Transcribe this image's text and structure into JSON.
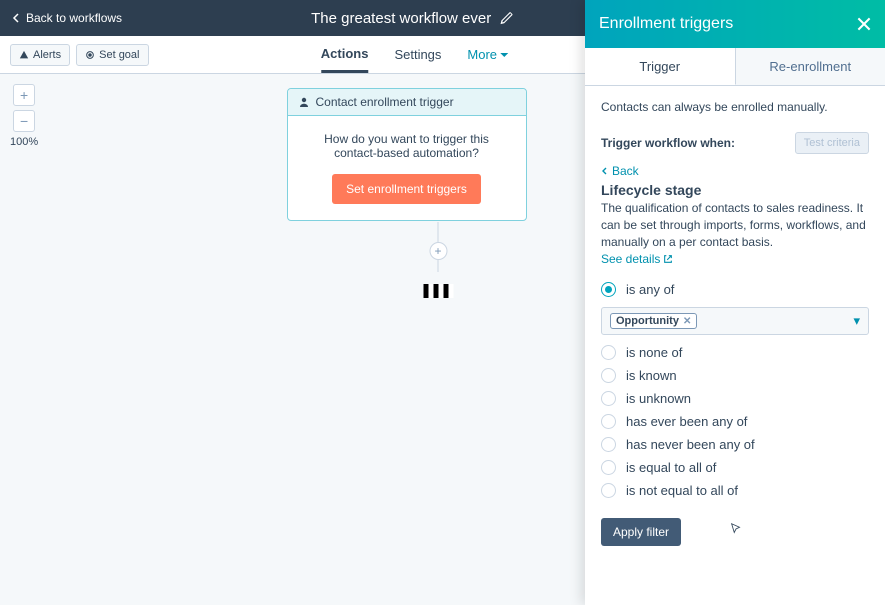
{
  "topbar": {
    "back_label": "Back to workflows",
    "title": "The greatest workflow ever"
  },
  "toolbar": {
    "alerts_label": "Alerts",
    "set_goal_label": "Set goal",
    "tabs": {
      "actions": "Actions",
      "settings": "Settings",
      "more": "More"
    }
  },
  "zoom": {
    "percent": "100%"
  },
  "enroll_card": {
    "header": "Contact enrollment trigger",
    "question": "How do you want to trigger this contact-based automation?",
    "button": "Set enrollment triggers"
  },
  "panel": {
    "title": "Enrollment triggers",
    "tabs": {
      "trigger": "Trigger",
      "reenrollment": "Re-enrollment"
    },
    "manual_note": "Contacts can always be enrolled manually.",
    "trigger_when": "Trigger workflow when:",
    "test_criteria": "Test criteria",
    "back": "Back",
    "filter_title": "Lifecycle stage",
    "filter_desc": "The qualification of contacts to sales readiness. It can be set through imports, forms, workflows, and manually on a per contact basis.",
    "see_details": "See details",
    "options": {
      "is_any_of": "is any of",
      "is_none_of": "is none of",
      "is_known": "is known",
      "is_unknown": "is unknown",
      "has_ever_been_any_of": "has ever been any of",
      "has_never_been_any_of": "has never been any of",
      "is_equal_to_all_of": "is equal to all of",
      "is_not_equal_to_all_of": "is not equal to all of"
    },
    "chip": "Opportunity",
    "apply": "Apply filter"
  }
}
